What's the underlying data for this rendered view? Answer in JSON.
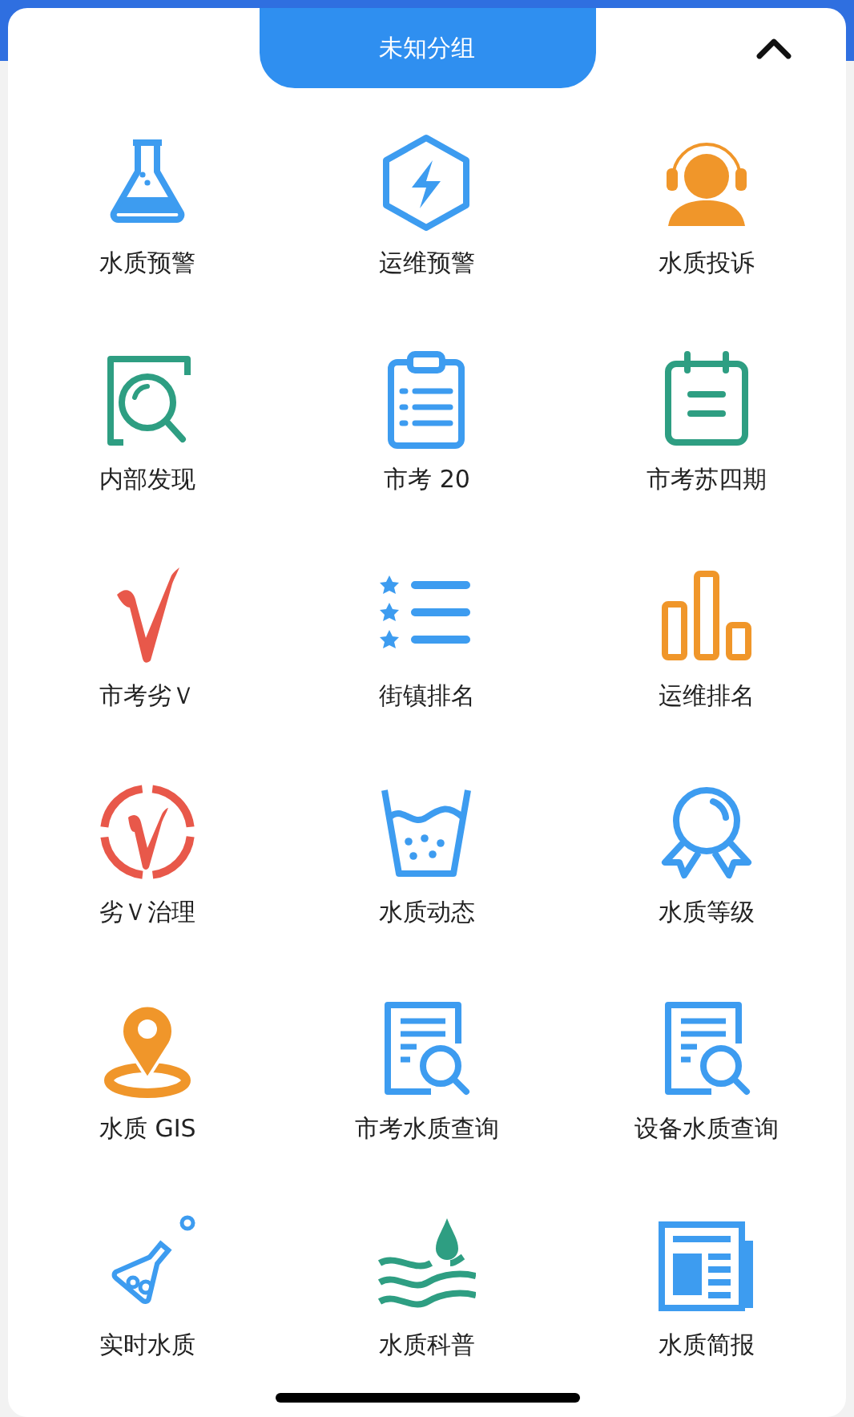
{
  "group_tab": {
    "title": "未知分组"
  },
  "items": [
    {
      "label": "水质预警"
    },
    {
      "label": "运维预警"
    },
    {
      "label": "水质投诉"
    },
    {
      "label": "内部发现"
    },
    {
      "label": "市考 20"
    },
    {
      "label": "市考苏四期"
    },
    {
      "label": "市考劣Ｖ"
    },
    {
      "label": "街镇排名"
    },
    {
      "label": "运维排名"
    },
    {
      "label": "劣Ｖ治理"
    },
    {
      "label": "水质动态"
    },
    {
      "label": "水质等级"
    },
    {
      "label": "水质 GIS"
    },
    {
      "label": "市考水质查询"
    },
    {
      "label": "设备水质查询"
    },
    {
      "label": "实时水质"
    },
    {
      "label": "水质科普"
    },
    {
      "label": "水质简报"
    }
  ]
}
